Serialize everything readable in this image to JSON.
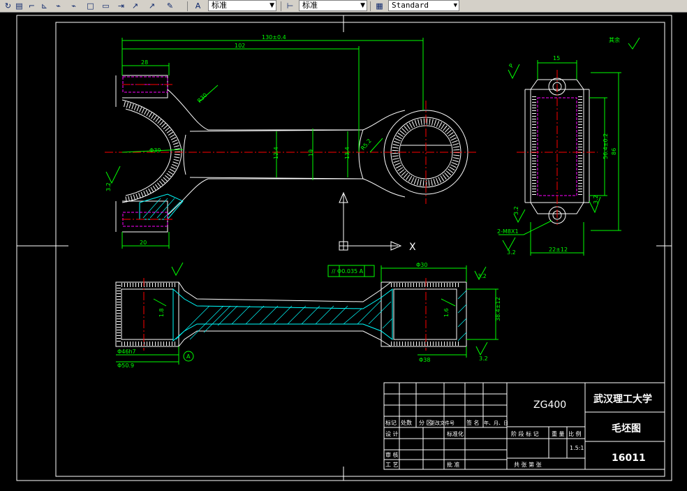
{
  "toolbar": {
    "text_style": "标准",
    "dim_style": "标准",
    "table_style": "Standard",
    "icons": [
      "refresh-icon",
      "save-icon",
      "line-icon",
      "dimension-icon",
      "dimension-icon",
      "rectangle-icon",
      "rectangle-icon",
      "arrow-icon",
      "arc-icon",
      "magic-icon",
      "text-style-icon",
      "dim-style-icon",
      "table-style-icon"
    ]
  },
  "drawing": {
    "dims": {
      "overall_len": "130±0.4",
      "center_dist": "102",
      "small_end_width": "28",
      "big_bore_dia": "Φ39",
      "left_bottom": "20",
      "shank_w1": "12.4",
      "shank_w2": "19",
      "shank_w3": "13.4",
      "r_label": "R30",
      "r_small": "R5.2",
      "roughness_left": "3.2",
      "side_top": "15",
      "side_height": "86",
      "side_inner": "56.4±0.2",
      "side_bottom": "22±12",
      "side_hole": "2-M8X1",
      "side_r32a": "3.2",
      "side_r32b": "3.2",
      "side_r32c": "3.2",
      "note_corner": "其余",
      "tol_frame": "// Φ0.035 A",
      "bot_top": "Φ30",
      "bot_left1": "Φ46h7",
      "bot_left2": "Φ50.9",
      "bot_right": "Φ38",
      "bot_height": "38.4±12",
      "bot_inner_l": "1.8",
      "bot_inner_r": "1.6",
      "bot_r32a": "3.2",
      "bot_r32b": "3.2",
      "datum": "A",
      "p_small": "P"
    },
    "coords": "X"
  },
  "title_block": {
    "material": "ZG400",
    "school": "武汉理工大学",
    "drawing_name": "毛坯图",
    "drawing_no": "16011",
    "row_labels": [
      "标记",
      "处数",
      "分 区",
      "更改文件号",
      "签 名",
      "年、月、日"
    ],
    "design": "设 计",
    "standard": "标准化",
    "check": "审 核",
    "process": "工 艺",
    "approve": "批 准",
    "stage": "阶 段 标 记",
    "weight": "重 量",
    "scale_label": "比 例",
    "scale": "1.5:1",
    "sheets": "共    张  第    张"
  }
}
